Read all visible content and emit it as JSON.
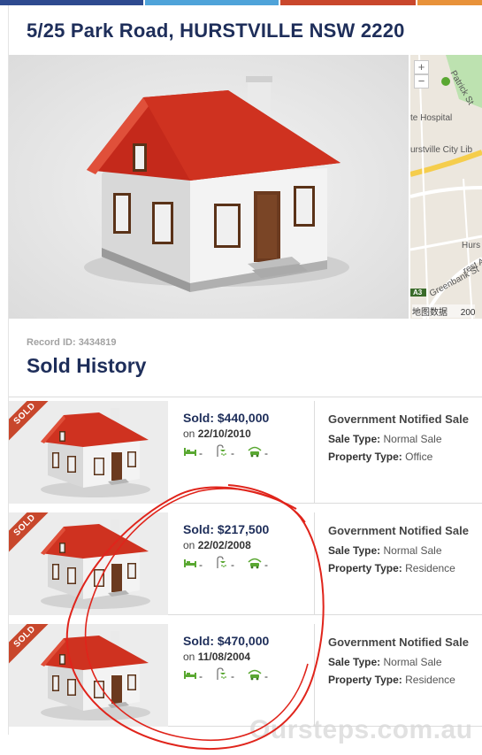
{
  "header": {
    "title": "5/25 Park Road, HURSTVILLE NSW 2220",
    "stripe_colors": [
      "#2e4a8f",
      "#4fa3d9",
      "#c9472c",
      "#e8923a"
    ]
  },
  "map": {
    "zoom_in": "+",
    "zoom_out": "−",
    "labels": [
      "Patrick St",
      "te Hospital",
      "urstville City Lib",
      "Hurs",
      "Greenbank St",
      "rest A",
      "A3"
    ],
    "attribution_left": "地图数据",
    "attribution_right": "200"
  },
  "record": {
    "label": "Record ID:",
    "id": "3434819"
  },
  "section_title": "Sold History",
  "sales": [
    {
      "badge": "SOLD",
      "price": "Sold: $440,000",
      "date_prefix": "on",
      "date": "22/10/2010",
      "beds": "-",
      "baths": "-",
      "cars": "-",
      "gov_label": "Government Notified Sale",
      "sale_type_label": "Sale Type:",
      "sale_type": "Normal Sale",
      "property_type_label": "Property Type:",
      "property_type": "Office"
    },
    {
      "badge": "SOLD",
      "price": "Sold: $217,500",
      "date_prefix": "on",
      "date": "22/02/2008",
      "beds": "-",
      "baths": "-",
      "cars": "-",
      "gov_label": "Government Notified Sale",
      "sale_type_label": "Sale Type:",
      "sale_type": "Normal Sale",
      "property_type_label": "Property Type:",
      "property_type": "Residence"
    },
    {
      "badge": "SOLD",
      "price": "Sold: $470,000",
      "date_prefix": "on",
      "date": "11/08/2004",
      "beds": "-",
      "baths": "-",
      "cars": "-",
      "gov_label": "Government Notified Sale",
      "sale_type_label": "Sale Type:",
      "sale_type": "Normal Sale",
      "property_type_label": "Property Type:",
      "property_type": "Residence"
    }
  ],
  "watermark": "Oursteps.com.au",
  "colors": {
    "title": "#1e2e5a",
    "ribbon": "#c8472c",
    "icon_green": "#5aa832",
    "annotation": "#e0241b"
  }
}
